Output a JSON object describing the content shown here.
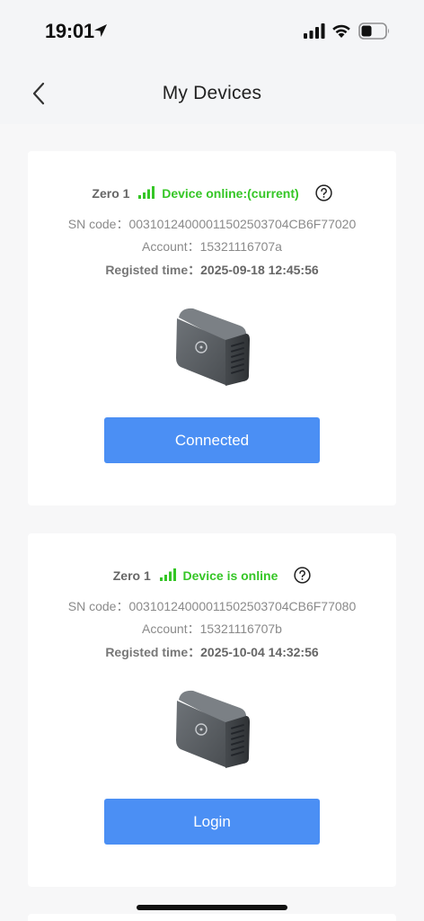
{
  "status_bar": {
    "time": "19:01",
    "icons": [
      "location-arrow-icon",
      "cellular-signal-icon",
      "wifi-icon",
      "battery-icon"
    ]
  },
  "header": {
    "title": "My Devices",
    "back_icon": "chevron-left-icon"
  },
  "colors": {
    "accent_button": "#4b8ff4",
    "online_green": "#35c626",
    "background": "#f4f5f7"
  },
  "devices": [
    {
      "model": "Zero 1",
      "status": "Device online:(current)",
      "signal_icon": "signal-bars-icon",
      "help_icon": "question-circle-icon",
      "sn_label": "SN code：",
      "sn_value": "00310124000011502503704CB6F77020",
      "account_label": "Account：",
      "account_value": "15321116707a",
      "registed_label": "Registed time：",
      "registed_value": "2025-09-18 12:45:56",
      "button_label": "Connected"
    },
    {
      "model": "Zero 1",
      "status": "Device is online",
      "signal_icon": "signal-bars-icon",
      "help_icon": "question-circle-icon",
      "sn_label": "SN code：",
      "sn_value": "00310124000011502503704CB6F77080",
      "account_label": "Account：",
      "account_value": "15321116707b",
      "registed_label": "Registed time：",
      "registed_value": "2025-10-04 14:32:56",
      "button_label": "Login"
    }
  ]
}
